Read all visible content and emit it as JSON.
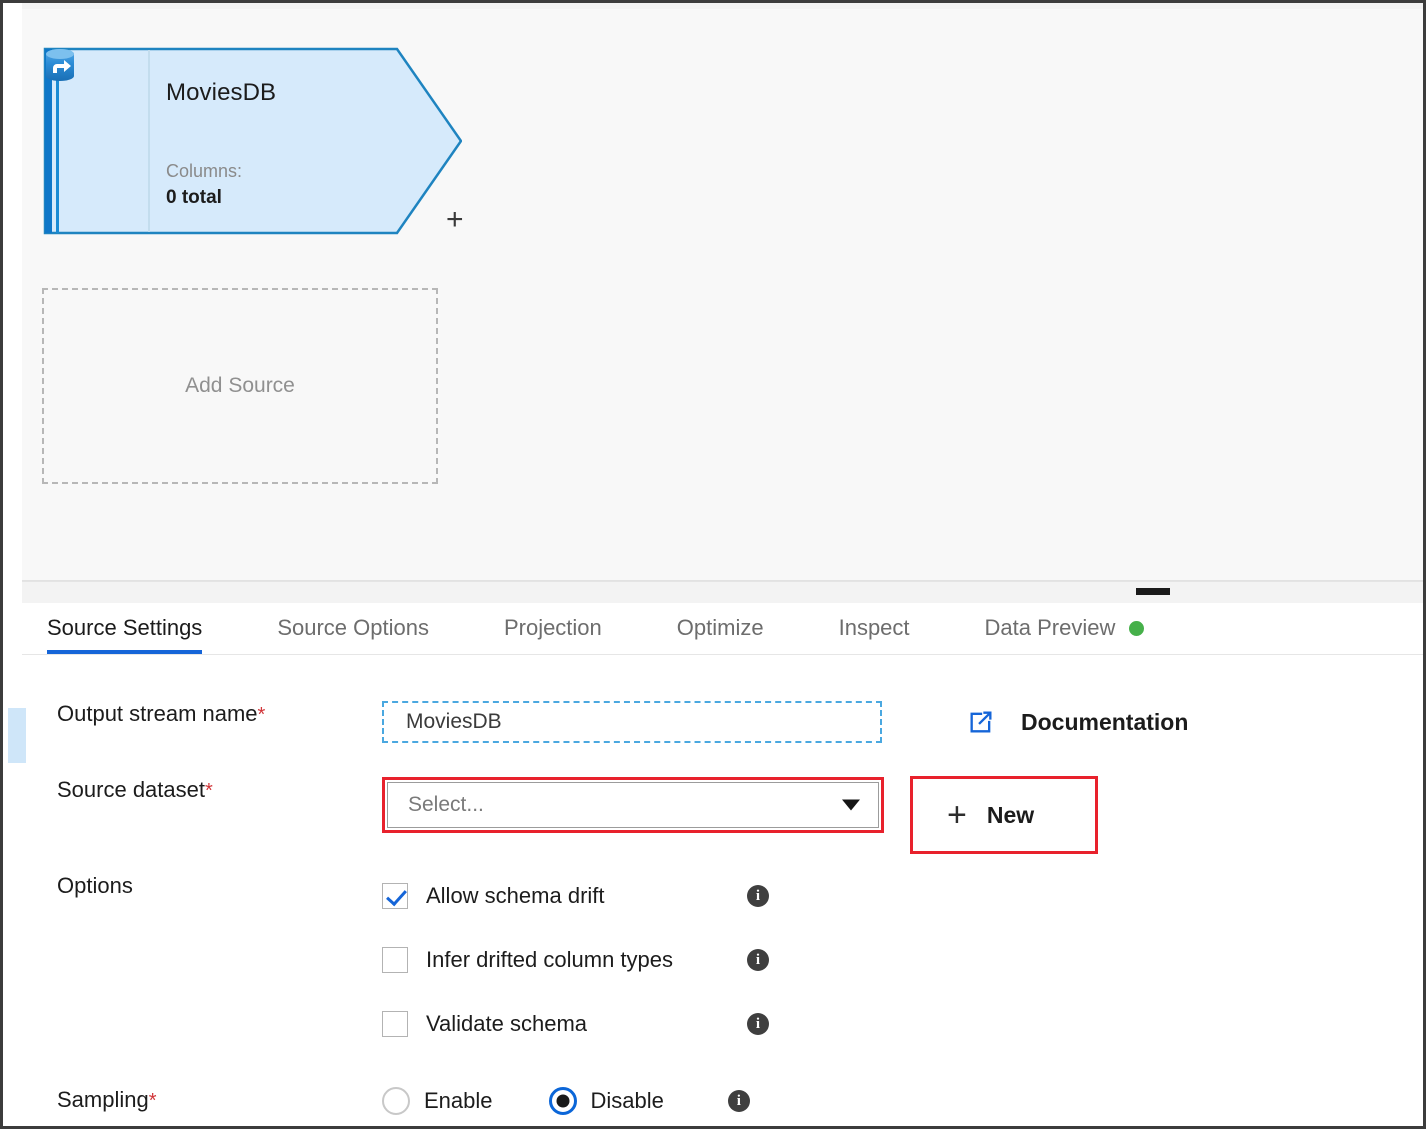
{
  "canvas": {
    "source_node": {
      "title": "MoviesDB",
      "columns_label": "Columns:",
      "columns_value": "0 total",
      "add_button": "+",
      "icon": "database-source-icon",
      "fill_color": "#d6eafb",
      "stroke_color": "#1f84c0",
      "bar_color": "#0f77c8"
    },
    "add_source": {
      "label": "Add Source"
    }
  },
  "splitter": {
    "grip": "drag-handle"
  },
  "panel": {
    "tabs": [
      {
        "label": "Source Settings",
        "active": true,
        "dot": false
      },
      {
        "label": "Source Options",
        "active": false,
        "dot": false
      },
      {
        "label": "Projection",
        "active": false,
        "dot": false
      },
      {
        "label": "Optimize",
        "active": false,
        "dot": false
      },
      {
        "label": "Inspect",
        "active": false,
        "dot": false
      },
      {
        "label": "Data Preview",
        "active": false,
        "dot": true
      }
    ],
    "tab_accent_color": "#1565d8",
    "status_dot_color": "#46b04a",
    "form": {
      "output_stream": {
        "label": "Output stream name",
        "required": "*",
        "value": "MoviesDB",
        "placeholder": ""
      },
      "documentation": {
        "label": "Documentation",
        "icon": "external-link-icon",
        "icon_color": "#1565d8"
      },
      "source_dataset": {
        "label": "Source dataset",
        "required": "*",
        "value": "Select...",
        "highlight_color": "#e8212c"
      },
      "new_button": {
        "label": "New",
        "plus": "+",
        "highlight_color": "#e8212c"
      },
      "options": {
        "label": "Options",
        "items": [
          {
            "label": "Allow schema drift",
            "checked": true,
            "info": "i"
          },
          {
            "label": "Infer drifted column types",
            "checked": false,
            "info": "i"
          },
          {
            "label": "Validate schema",
            "checked": false,
            "info": "i"
          }
        ]
      },
      "sampling": {
        "label": "Sampling",
        "required": "*",
        "options": [
          {
            "label": "Enable",
            "selected": false
          },
          {
            "label": "Disable",
            "selected": true
          }
        ],
        "info": "i"
      }
    }
  }
}
